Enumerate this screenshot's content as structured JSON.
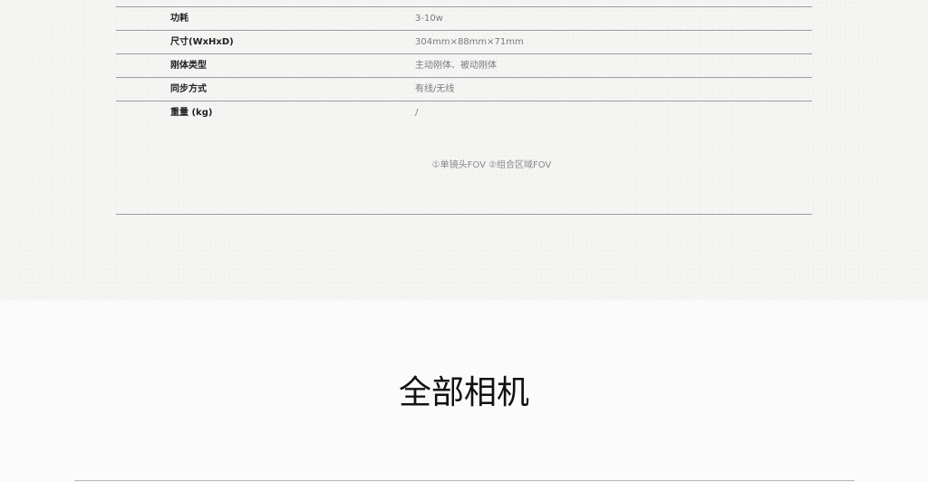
{
  "specs": {
    "rows": [
      {
        "label": "功耗",
        "value": "3-10w"
      },
      {
        "label": "尺寸(WxHxD)",
        "value": "304mm×88mm×71mm"
      },
      {
        "label": "刚体类型",
        "value": "主动刚体、被动刚体"
      },
      {
        "label": "同步方式",
        "value": "有线/无线"
      },
      {
        "label": "重量 (kg)",
        "value": "/"
      }
    ],
    "footnote": "①单镜头FOV ②组合区域FOV"
  },
  "all_cameras": {
    "title": "全部相机"
  }
}
